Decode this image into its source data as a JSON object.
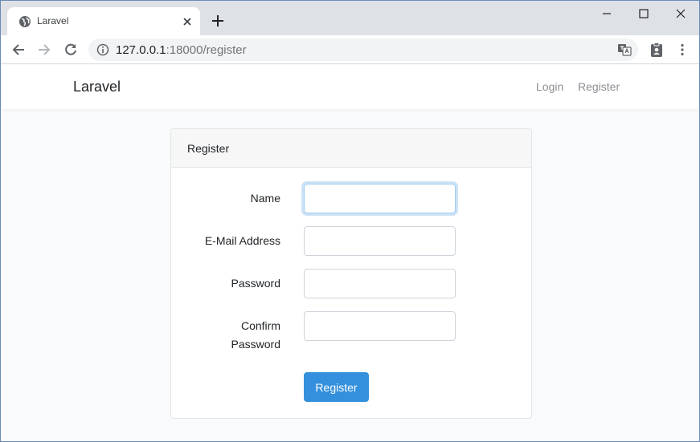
{
  "browser": {
    "tab_title": "Laravel",
    "url_host": "127.0.0.1",
    "url_rest": ":18000/register"
  },
  "navbar": {
    "brand": "Laravel",
    "login": "Login",
    "register": "Register"
  },
  "card": {
    "header": "Register",
    "fields": {
      "name_label": "Name",
      "email_label": "E-Mail Address",
      "password_label": "Password",
      "confirm_label_line1": "Confirm",
      "confirm_label_line2": "Password",
      "name_value": "",
      "email_value": "",
      "password_value": "",
      "confirm_value": ""
    },
    "submit_label": "Register"
  },
  "colors": {
    "primary": "#3490dc",
    "page_bg": "#f8fafc"
  }
}
